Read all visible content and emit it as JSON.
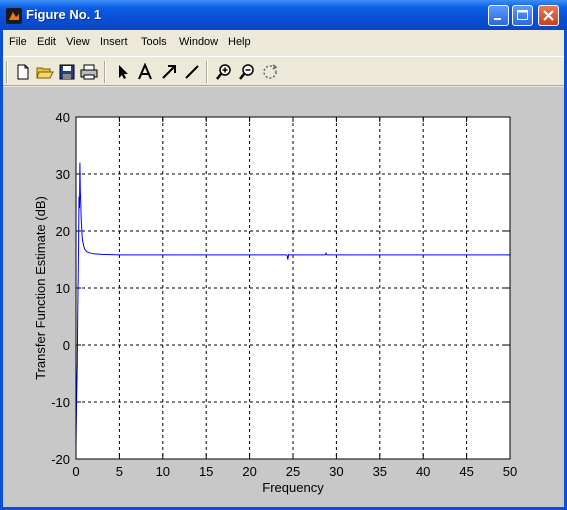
{
  "window": {
    "title": "Figure No. 1"
  },
  "menu": {
    "items": [
      "File",
      "Edit",
      "View",
      "Insert",
      "Tools",
      "Window",
      "Help"
    ]
  },
  "toolbar": {
    "icons": [
      "new-file-icon",
      "open-folder-icon",
      "save-icon",
      "print-icon",
      "select-arrow-icon",
      "text-icon",
      "arrow-icon",
      "line-icon",
      "zoom-in-icon",
      "zoom-out-icon",
      "rotate-icon"
    ]
  },
  "colors": {
    "line": "#0000ff",
    "axes_bg": "#ffffff",
    "figure_bg": "#c8c8c8"
  },
  "chart_data": {
    "type": "line",
    "title": "",
    "xlabel": "Frequency",
    "ylabel": "Transfer Function Estimate (dB)",
    "xlim": [
      0,
      50
    ],
    "ylim": [
      -20,
      40
    ],
    "xticks": [
      0,
      5,
      10,
      15,
      20,
      25,
      30,
      35,
      40,
      45,
      50
    ],
    "yticks": [
      -20,
      -10,
      0,
      10,
      20,
      30,
      40
    ],
    "grid": true,
    "series": [
      {
        "color": "#0000ff",
        "x": [
          0.0,
          0.05,
          0.1,
          0.15,
          0.2,
          0.25,
          0.3,
          0.35,
          0.4,
          0.45,
          0.5,
          0.55,
          0.6,
          0.65,
          0.7,
          0.8,
          0.9,
          1.0,
          1.2,
          1.5,
          2.0,
          3.0,
          5.0,
          8.0,
          12.0,
          20.0,
          24.3,
          24.4,
          24.5,
          24.6,
          28.7,
          28.8,
          28.9,
          35.0,
          50.0
        ],
        "y": [
          -18,
          -12,
          -7,
          -3,
          5,
          12,
          18,
          26,
          24,
          32,
          27,
          25,
          22,
          21,
          19,
          18,
          17.3,
          16.8,
          16.4,
          16.2,
          16.0,
          15.9,
          15.8,
          15.8,
          15.8,
          15.8,
          15.8,
          15.0,
          15.9,
          15.8,
          15.8,
          16.1,
          15.8,
          15.8,
          15.8
        ]
      }
    ]
  }
}
